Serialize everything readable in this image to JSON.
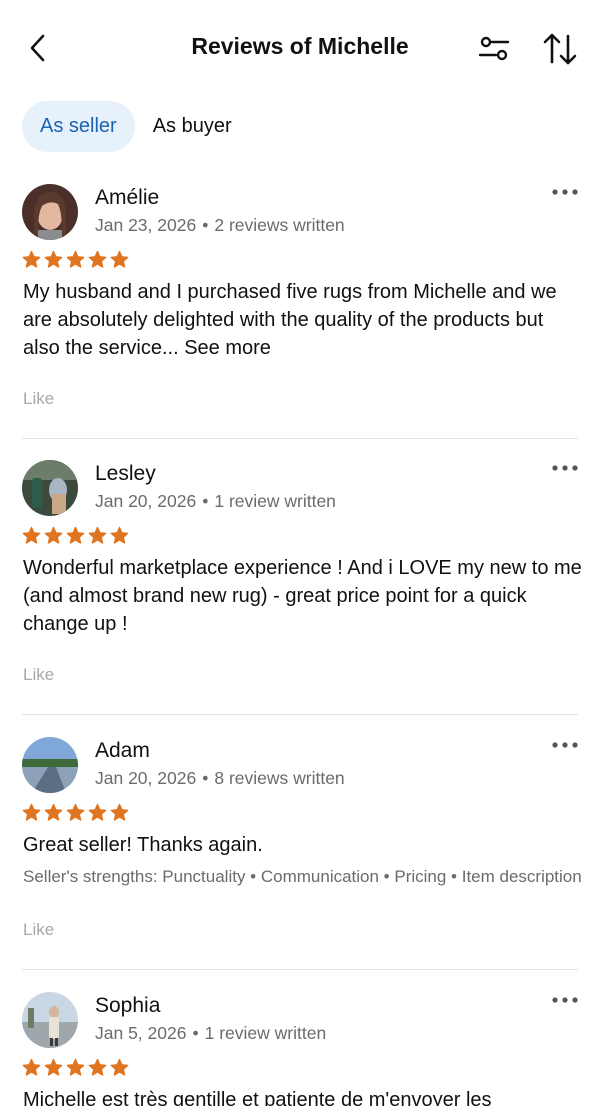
{
  "header": {
    "title": "Reviews of Michelle",
    "back_icon": "chevron-left-icon",
    "filter_icon": "filter-sliders-icon",
    "sort_icon": "sort-arrows-icon"
  },
  "tabs": [
    {
      "label": "As seller",
      "active": true
    },
    {
      "label": "As buyer",
      "active": false
    }
  ],
  "colors": {
    "accent": "#1a62b4",
    "tab_bg": "#e6f1fb",
    "star": "#e0741f",
    "muted": "#6b6b6b"
  },
  "reviews": [
    {
      "name": "Amélie",
      "date": "Jan 23, 2026",
      "separator": "•",
      "count": "2 reviews written",
      "rating": 5,
      "text": "My husband and I purchased five rugs from Michelle and we are absolutely delighted with the quality of the products but also the service...",
      "see_more": "See more",
      "like": "Like"
    },
    {
      "name": "Lesley",
      "date": "Jan 20, 2026",
      "separator": "•",
      "count": "1 review written",
      "rating": 5,
      "text": "Wonderful marketplace experience ! And i LOVE my new to me (and almost brand new rug) - great price point for a quick change up !",
      "like": "Like"
    },
    {
      "name": "Adam",
      "date": "Jan 20, 2026",
      "separator": "•",
      "count": "8 reviews written",
      "rating": 5,
      "text": "Great seller! Thanks again.",
      "strengths": "Seller's strengths: Punctuality • Communication • Pricing • Item description",
      "like": "Like"
    },
    {
      "name": "Sophia",
      "date": "Jan 5, 2026",
      "separator": "•",
      "count": "1 review written",
      "rating": 5,
      "text": "Michelle est très gentille et patiente de m'envoyer les"
    }
  ]
}
